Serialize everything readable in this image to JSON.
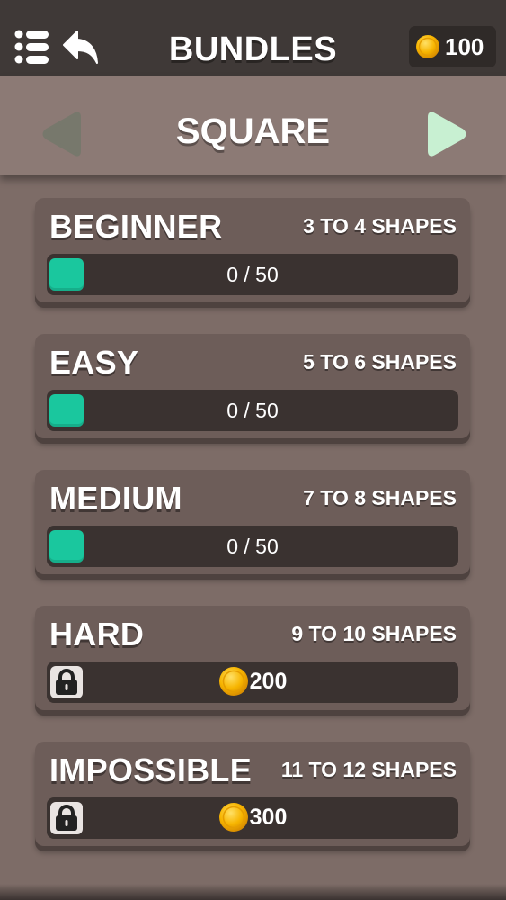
{
  "header": {
    "title": "BUNDLES",
    "coin_balance": "100",
    "menu_icon": "list-menu-icon",
    "back_icon": "back-arrow-icon"
  },
  "category": {
    "name": "SQUARE",
    "prev_icon": "triangle-left-icon",
    "next_icon": "triangle-right-icon"
  },
  "bundles": [
    {
      "name": "BEGINNER",
      "range": "3 TO 4 SHAPES",
      "status": "unlocked",
      "progress": "0 / 50",
      "completed": 0,
      "total": 50
    },
    {
      "name": "EASY",
      "range": "5 TO 6 SHAPES",
      "status": "unlocked",
      "progress": "0 / 50",
      "completed": 0,
      "total": 50
    },
    {
      "name": "MEDIUM",
      "range": "7 TO 8 SHAPES",
      "status": "unlocked",
      "progress": "0 / 50",
      "completed": 0,
      "total": 50
    },
    {
      "name": "HARD",
      "range": "9 TO 10 SHAPES",
      "status": "locked",
      "price": "200"
    },
    {
      "name": "IMPOSSIBLE",
      "range": "11 TO 12 SHAPES",
      "status": "locked",
      "price": "300"
    }
  ],
  "colors": {
    "accent": "#1ac79e",
    "background": "#7d6c67",
    "topbar": "#3f3937",
    "card": "#6d5d59",
    "track": "#3a3230",
    "coin": "#f5a800",
    "arrow_active": "#c8f0d2",
    "arrow_inactive": "#77786c"
  }
}
